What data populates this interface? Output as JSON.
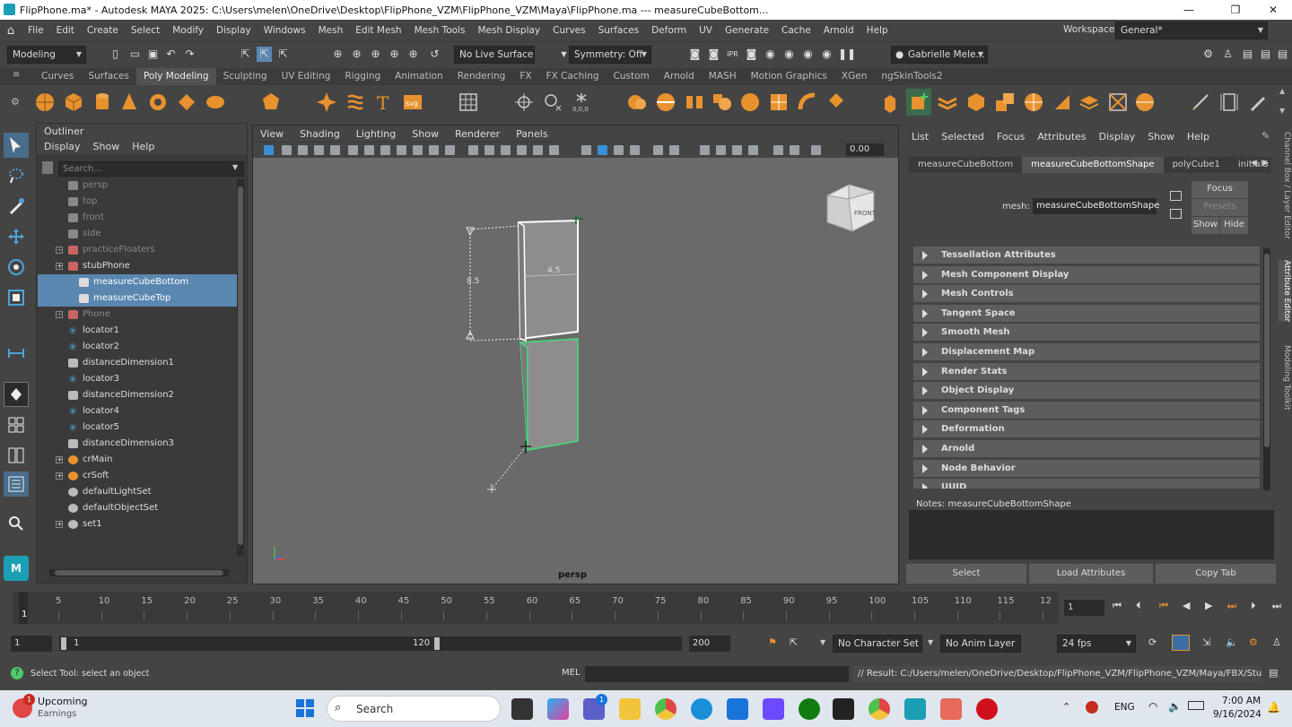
{
  "window": {
    "title": "FlipPhone.ma* - Autodesk MAYA 2025: C:\\Users\\melen\\OneDrive\\Desktop\\FlipPhone_VZM\\FlipPhone_VZM\\Maya\\FlipPhone.ma   ---   measureCubeBottom...",
    "minimize": "—",
    "maximize": "❐",
    "close": "✕"
  },
  "menubar": {
    "items": [
      "File",
      "Edit",
      "Create",
      "Select",
      "Modify",
      "Display",
      "Windows",
      "Mesh",
      "Edit Mesh",
      "Mesh Tools",
      "Mesh Display",
      "Curves",
      "Surfaces",
      "Deform",
      "UV",
      "Generate",
      "Cache",
      "Arnold",
      "Help"
    ],
    "workspace_label": "Workspace:",
    "workspace_value": "General*"
  },
  "statusline": {
    "mode": "Modeling",
    "live_surface": "No Live Surface",
    "symmetry": "Symmetry: Off",
    "user": "Gabrielle Mele..."
  },
  "shelf_tabs": {
    "items": [
      "Curves",
      "Surfaces",
      "Poly Modeling",
      "Sculpting",
      "UV Editing",
      "Rigging",
      "Animation",
      "Rendering",
      "FX",
      "FX Caching",
      "Custom",
      "Arnold",
      "MASH",
      "Motion Graphics",
      "XGen",
      "ngSkinTools2"
    ],
    "active": "Poly Modeling"
  },
  "outliner": {
    "title": "Outliner",
    "menu": [
      "Display",
      "Show",
      "Help"
    ],
    "search_placeholder": "Search...",
    "rows": [
      {
        "label": "persp",
        "dim": true,
        "icon": "camera-icon",
        "indent": 0,
        "expander": false,
        "selected": false
      },
      {
        "label": "top",
        "dim": true,
        "icon": "camera-icon",
        "indent": 0,
        "expander": false,
        "selected": false
      },
      {
        "label": "front",
        "dim": true,
        "icon": "camera-icon",
        "indent": 0,
        "expander": false,
        "selected": false
      },
      {
        "label": "side",
        "dim": true,
        "icon": "camera-icon",
        "indent": 0,
        "expander": false,
        "selected": false
      },
      {
        "label": "practiceFloaters",
        "dim": true,
        "icon": "group-icon",
        "indent": 0,
        "expander": true,
        "selected": false
      },
      {
        "label": "stubPhone",
        "dim": false,
        "icon": "group-icon",
        "indent": 0,
        "expander": true,
        "selected": false
      },
      {
        "label": "measureCubeBottom",
        "dim": false,
        "icon": "mesh-icon",
        "indent": 1,
        "expander": false,
        "selected": true
      },
      {
        "label": "measureCubeTop",
        "dim": false,
        "icon": "mesh-icon",
        "indent": 1,
        "expander": false,
        "selected": true
      },
      {
        "label": "Phone",
        "dim": true,
        "icon": "group-icon",
        "indent": 0,
        "expander": true,
        "selected": false
      },
      {
        "label": "locator1",
        "dim": false,
        "icon": "locator-icon",
        "indent": 0,
        "expander": false,
        "selected": false
      },
      {
        "label": "locator2",
        "dim": false,
        "icon": "locator-icon",
        "indent": 0,
        "expander": false,
        "selected": false
      },
      {
        "label": "distanceDimension1",
        "dim": false,
        "icon": "distance-icon",
        "indent": 0,
        "expander": false,
        "selected": false
      },
      {
        "label": "locator3",
        "dim": false,
        "icon": "locator-icon",
        "indent": 0,
        "expander": false,
        "selected": false
      },
      {
        "label": "distanceDimension2",
        "dim": false,
        "icon": "distance-icon",
        "indent": 0,
        "expander": false,
        "selected": false
      },
      {
        "label": "locator4",
        "dim": false,
        "icon": "locator-icon",
        "indent": 0,
        "expander": false,
        "selected": false
      },
      {
        "label": "locator5",
        "dim": false,
        "icon": "locator-icon",
        "indent": 0,
        "expander": false,
        "selected": false
      },
      {
        "label": "distanceDimension3",
        "dim": false,
        "icon": "distance-icon",
        "indent": 0,
        "expander": false,
        "selected": false
      },
      {
        "label": "crMain",
        "dim": false,
        "icon": "rig-icon",
        "indent": 0,
        "expander": true,
        "selected": false
      },
      {
        "label": "crSoft",
        "dim": false,
        "icon": "rig-icon",
        "indent": 0,
        "expander": true,
        "selected": false
      },
      {
        "label": "defaultLightSet",
        "dim": false,
        "icon": "set-icon",
        "indent": 0,
        "expander": false,
        "selected": false
      },
      {
        "label": "defaultObjectSet",
        "dim": false,
        "icon": "set-icon",
        "indent": 0,
        "expander": false,
        "selected": false
      },
      {
        "label": "set1",
        "dim": false,
        "icon": "set-icon",
        "indent": 0,
        "expander": true,
        "selected": false
      }
    ]
  },
  "viewport": {
    "menu": [
      "View",
      "Shading",
      "Lighting",
      "Show",
      "Renderer",
      "Panels"
    ],
    "exposure_value": "0.00",
    "camera_label": "persp",
    "viewcube_label": "FRONT",
    "dim_height": "8.5",
    "dim_width": "4.5"
  },
  "attribute_editor": {
    "menu": [
      "List",
      "Selected",
      "Focus",
      "Attributes",
      "Display",
      "Show",
      "Help"
    ],
    "tabs": [
      "measureCubeBottom",
      "measureCubeBottomShape",
      "polyCube1",
      "initialS"
    ],
    "active_tab": "measureCubeBottomShape",
    "mesh_label": "mesh:",
    "mesh_value": "measureCubeBottomShape",
    "focus": "Focus",
    "presets": "Presets",
    "show": "Show",
    "hide": "Hide",
    "sections": [
      "Tessellation Attributes",
      "Mesh Component Display",
      "Mesh Controls",
      "Tangent Space",
      "Smooth Mesh",
      "Displacement Map",
      "Render Stats",
      "Object Display",
      "Component Tags",
      "Deformation",
      "Arnold",
      "Node Behavior",
      "UUID"
    ],
    "notes_label": "Notes:  measureCubeBottomShape",
    "buttons": [
      "Select",
      "Load Attributes",
      "Copy Tab"
    ]
  },
  "side_tabs": [
    "Channel Box / Layer Editor",
    "Attribute Editor",
    "Modeling Toolkit"
  ],
  "timeslider": {
    "ticks": [
      "5",
      "10",
      "15",
      "20",
      "25",
      "30",
      "35",
      "40",
      "45",
      "50",
      "55",
      "60",
      "65",
      "70",
      "75",
      "80",
      "85",
      "90",
      "95",
      "100",
      "105",
      "110",
      "115",
      "12"
    ],
    "current_frame": "1",
    "frame_field": "1"
  },
  "range": {
    "start": "1",
    "inner_start": "1",
    "inner_end": "120",
    "end": "200",
    "character_set": "No Character Set",
    "anim_layer": "No Anim Layer",
    "fps": "24 fps"
  },
  "commandline": {
    "help": "Select Tool: select an object",
    "lang": "MEL",
    "result": "// Result: C:/Users/melen/OneDrive/Desktop/FlipPhone_VZM/FlipPhone_VZM/Maya/FBX/Stub.fbx"
  },
  "taskbar": {
    "widget_title": "Upcoming",
    "widget_sub": "Earnings",
    "widget_badge": "1",
    "search": "Search",
    "teams_badge": "1",
    "lang": "ENG",
    "time": "7:00 AM",
    "date": "9/16/2024"
  }
}
